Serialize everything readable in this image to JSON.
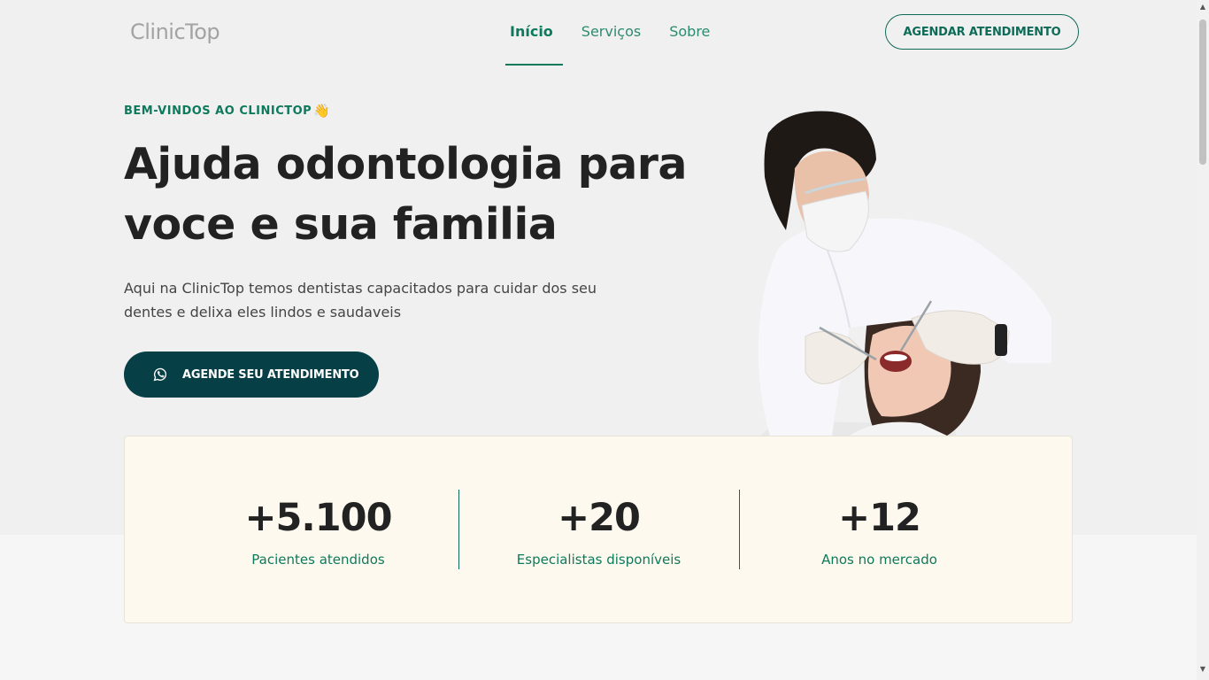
{
  "header": {
    "logo": "ClinicTop",
    "nav": [
      {
        "label": "Início",
        "active": true
      },
      {
        "label": "Serviços",
        "active": false
      },
      {
        "label": "Sobre",
        "active": false
      }
    ],
    "cta": "AGENDAR ATENDIMENTO"
  },
  "hero": {
    "eyebrow": "BEM-VINDOS AO CLINICTOP",
    "eyebrow_emoji": "👋",
    "headline": "Ajuda odontologia para voce e sua familia",
    "lead": "Aqui na ClinicTop temos dentistas capacitados para cuidar dos seu dentes e delixa eles lindos e saudaveis",
    "button": "AGENDE SEU ATENDIMENTO",
    "button_icon": "whatsapp-icon"
  },
  "stats": [
    {
      "value": "+5.100",
      "label": "Pacientes atendidos"
    },
    {
      "value": "+20",
      "label": "Especialistas disponíveis"
    },
    {
      "value": "+12",
      "label": "Anos no mercado"
    }
  ],
  "colors": {
    "brand_green": "#0d7a5c",
    "dark_teal": "#063f45",
    "stats_bg": "#fdf9ee"
  }
}
